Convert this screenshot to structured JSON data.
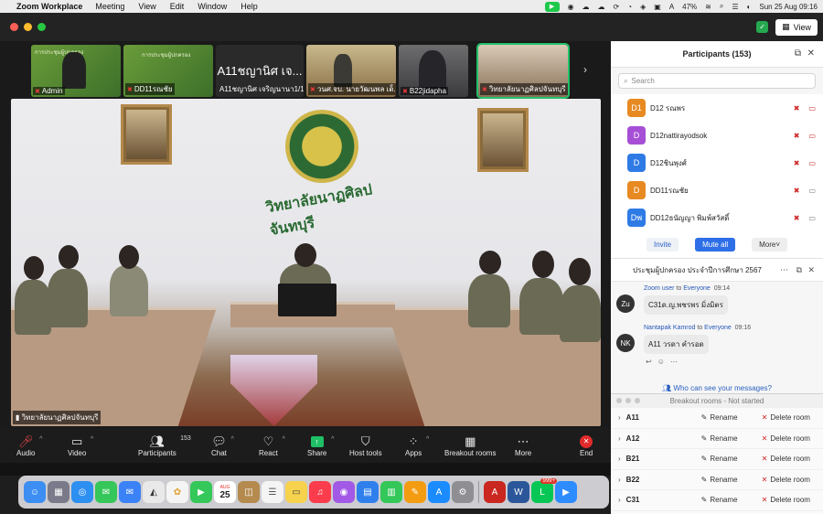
{
  "menubar": {
    "app_name": "Zoom Workplace",
    "menus": [
      "Meeting",
      "View",
      "Edit",
      "Window",
      "Help"
    ],
    "battery": "47%",
    "datetime": "Sun 25 Aug  09:16"
  },
  "window": {
    "view_label": "View"
  },
  "thumbnails": [
    {
      "name": "Admin",
      "line1": "การประชุมผู้ปกครอง",
      "muted": true
    },
    {
      "name": "DD11รณชัย",
      "line1": "การประชุมผู้ปกครอง",
      "muted": true
    },
    {
      "name": "A11ชญานิศ เจริญนานา1/1",
      "big": "A11ชญานิศ เจ...",
      "muted": false
    },
    {
      "name": "วนศ.จบ. นายวัฒนพล เด็...",
      "muted": true
    },
    {
      "name": "B22jidapha",
      "muted": true
    },
    {
      "name": "วิทยาลัยนาฏศิลปจันทบุรี",
      "muted": true
    }
  ],
  "main_video": {
    "participant": "วิทยาลัยนาฏศิลปจันทบุรี",
    "sign_text": "วิทยาลัยนาฏศิลปจันทบุรี"
  },
  "toolbar": {
    "audio": "Audio",
    "video": "Video",
    "participants": "Participants",
    "participants_count": "153",
    "chat": "Chat",
    "react": "React",
    "share": "Share",
    "host_tools": "Host tools",
    "apps": "Apps",
    "breakout_rooms": "Breakout rooms",
    "more": "More",
    "end": "End"
  },
  "participants_panel": {
    "title": "Participants (153)",
    "search_placeholder": "Search",
    "list": [
      {
        "avatar": "D1",
        "name": "D12 รณพร",
        "color": "#e78a22",
        "cam_off": true
      },
      {
        "avatar": "D",
        "name": "D12nattirayodsok",
        "color": "#a64ed6",
        "cam_off": true
      },
      {
        "avatar": "D",
        "name": "D12ชินพุงศ์",
        "color": "#2f7be6",
        "cam_off": true
      },
      {
        "avatar": "D",
        "name": "DD11รณชัย",
        "color": "#e78a22",
        "cam_off": false
      },
      {
        "avatar": "Dพ",
        "name": "DD12ธนัญญา พิมพ์สวัสดิ์",
        "color": "#2f7be6",
        "cam_off": false
      }
    ],
    "invite": "Invite",
    "mute_all": "Mute all",
    "more": "More"
  },
  "chat": {
    "title": "ประชุมผู้ปกครอง ประจำปีการศึกษา 2567",
    "messages": [
      {
        "avatar": "Zu",
        "from": "Zoom user",
        "to_word": "to",
        "to": "Everyone",
        "time": "09:14",
        "text": "C31ด.ญ.พชรพร มิ่งมิตร"
      },
      {
        "avatar": "NK",
        "from": "Nantapak Kamrod",
        "to_word": "to",
        "to": "Everyone",
        "time": "09:16",
        "text": "A11 วรดา  คำรอด"
      }
    ],
    "who_can_see": "Who can see your messages?"
  },
  "breakout": {
    "title": "Breakout rooms - Not started",
    "rename": "Rename",
    "delete": "Delete room",
    "rooms": [
      "A11",
      "A12",
      "B21",
      "B22",
      "C31"
    ]
  },
  "dock": {
    "calendar_day": "25",
    "calendar_month": "AUG",
    "badge": "999+"
  }
}
